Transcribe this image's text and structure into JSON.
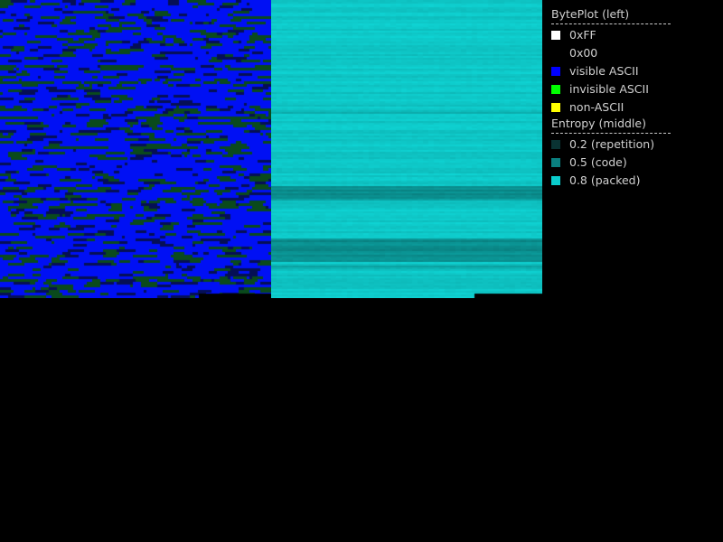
{
  "views": {
    "byteplot": {
      "name": "BytePlot",
      "position": "left"
    },
    "entropy": {
      "name": "Entropy",
      "position": "middle"
    }
  },
  "legend": {
    "byteplot_title": "BytePlot (left)",
    "byteplot_items": [
      {
        "label": "0xFF",
        "color": "#ffffff"
      },
      {
        "label": "0x00",
        "color": "#000000"
      },
      {
        "label": "visible ASCII",
        "color": "#0000ff"
      },
      {
        "label": "invisible ASCII",
        "color": "#00ff00"
      },
      {
        "label": "non-ASCII",
        "color": "#ffff00"
      }
    ],
    "entropy_title": "Entropy (middle)",
    "entropy_items": [
      {
        "label": "0.2 (repetition)",
        "color": "#0a3333"
      },
      {
        "label": "0.5 (code)",
        "color": "#0a8080"
      },
      {
        "label": "0.8 (packed)",
        "color": "#0acccc"
      }
    ]
  },
  "colors": {
    "background": "#000000",
    "byteplot_visible": "#0000ff",
    "byteplot_dark": "#0a1a6a",
    "byteplot_green": "#0a4a1a",
    "entropy_base": "#08aaaa"
  }
}
